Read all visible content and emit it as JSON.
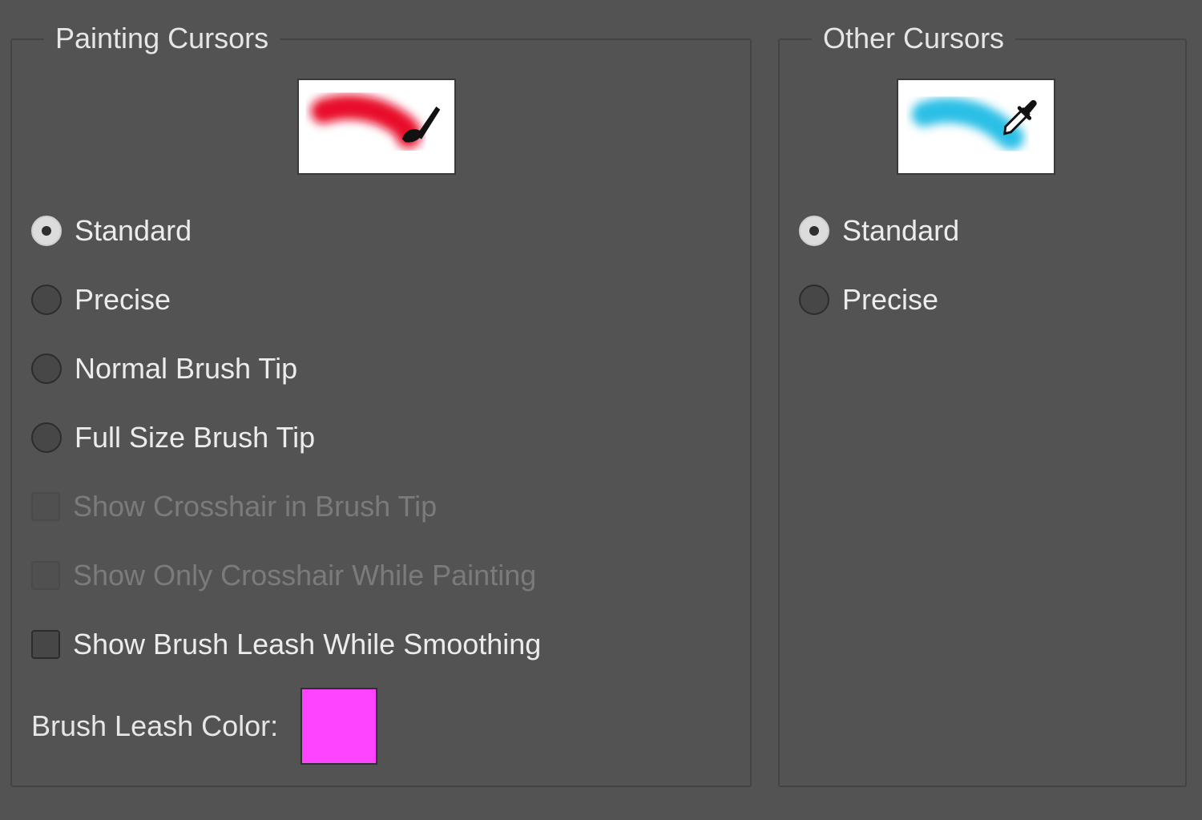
{
  "painting_cursors": {
    "title": "Painting Cursors",
    "preview_icon": "paintbrush-icon",
    "stroke_color": "#e8102a",
    "options": [
      {
        "label": "Standard",
        "type": "radio",
        "checked": true,
        "disabled": false
      },
      {
        "label": "Precise",
        "type": "radio",
        "checked": false,
        "disabled": false
      },
      {
        "label": "Normal Brush Tip",
        "type": "radio",
        "checked": false,
        "disabled": false
      },
      {
        "label": "Full Size Brush Tip",
        "type": "radio",
        "checked": false,
        "disabled": false
      },
      {
        "label": "Show Crosshair in Brush Tip",
        "type": "checkbox",
        "checked": false,
        "disabled": true
      },
      {
        "label": "Show Only Crosshair While Painting",
        "type": "checkbox",
        "checked": false,
        "disabled": true
      },
      {
        "label": "Show Brush Leash While Smoothing",
        "type": "checkbox",
        "checked": false,
        "disabled": false
      }
    ],
    "leash_color_label": "Brush Leash Color:",
    "leash_color": "#ff44ff"
  },
  "other_cursors": {
    "title": "Other Cursors",
    "preview_icon": "eyedropper-icon",
    "stroke_color": "#2bbfe6",
    "options": [
      {
        "label": "Standard",
        "type": "radio",
        "checked": true,
        "disabled": false
      },
      {
        "label": "Precise",
        "type": "radio",
        "checked": false,
        "disabled": false
      }
    ]
  }
}
